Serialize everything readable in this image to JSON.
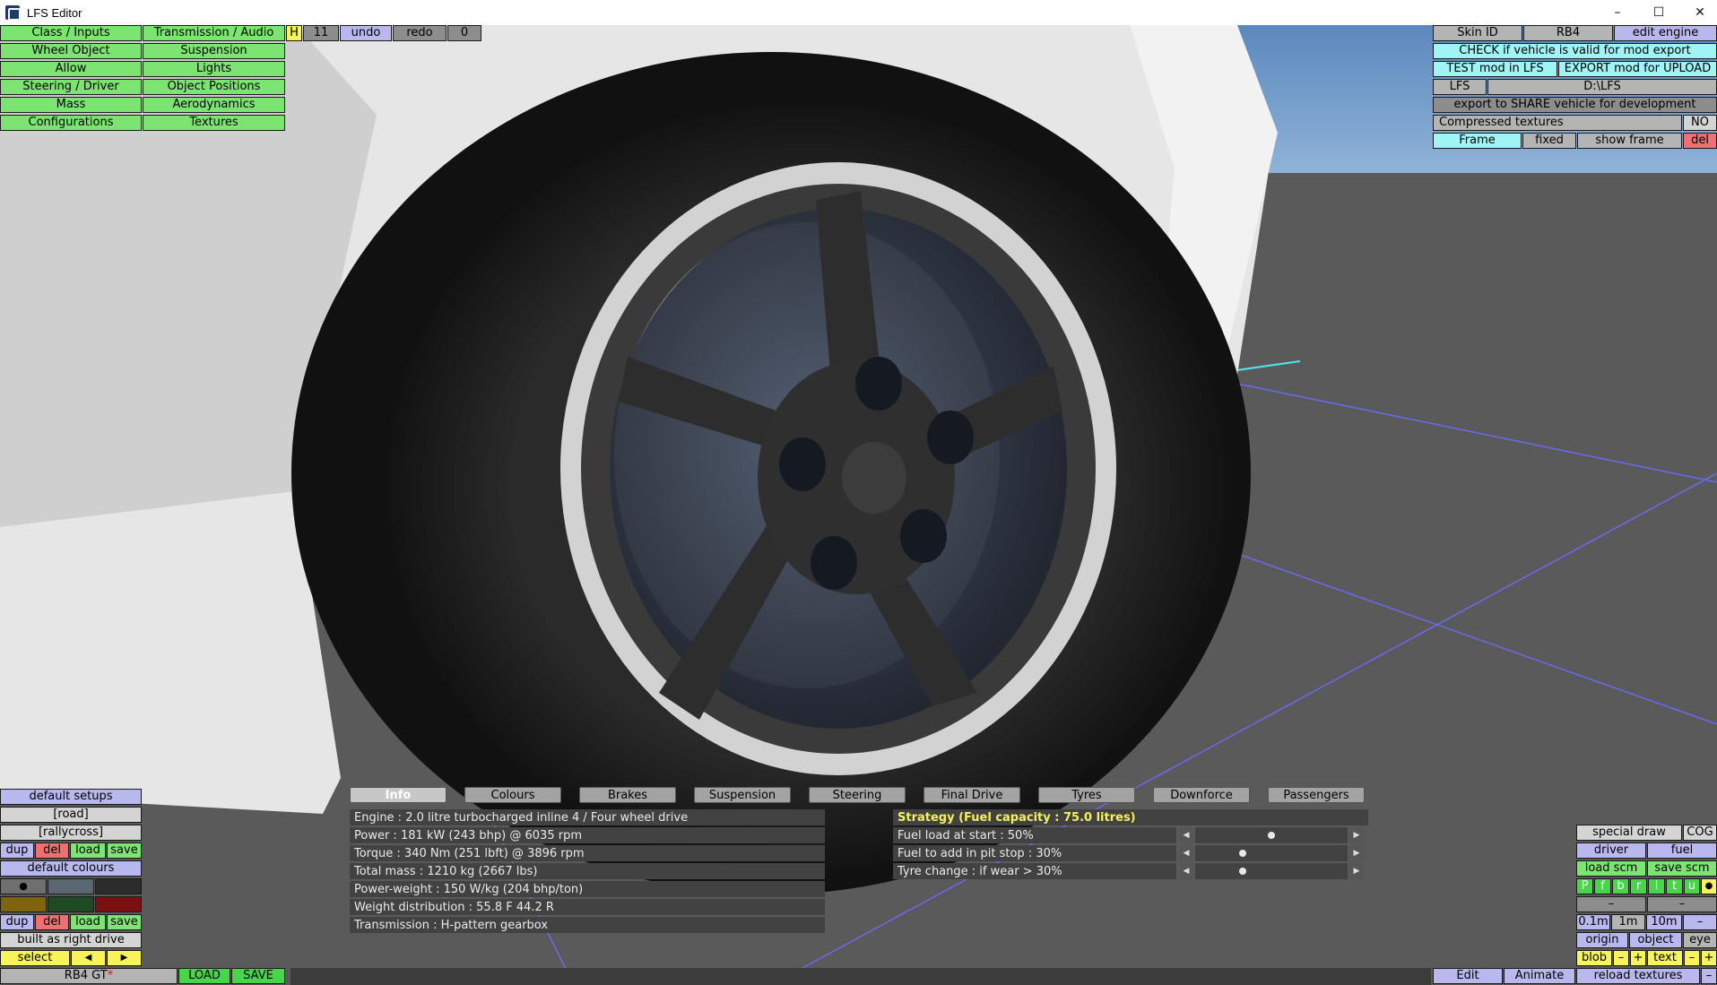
{
  "window": {
    "title": "LFS Editor",
    "minimize": "–",
    "maximize": "☐",
    "close": "✕"
  },
  "left_menu": {
    "col1": [
      "Class / Inputs",
      "Wheel Object",
      "Allow",
      "Steering / Driver",
      "Mass",
      "Configurations"
    ],
    "col2": [
      "Transmission / Audio",
      "Suspension",
      "Lights",
      "Object Positions",
      "Aerodynamics",
      "Textures"
    ]
  },
  "top_tools": {
    "h": "H",
    "count": "11",
    "undo": "undo",
    "redo": "redo",
    "redo_count": "0"
  },
  "right_panel": {
    "skin_id": "Skin ID",
    "car": "RB4",
    "edit_engine": "edit engine",
    "check": "CHECK if vehicle is valid for mod export",
    "test": "TEST mod in LFS",
    "export": "EXPORT mod for UPLOAD",
    "lfs": "LFS",
    "path": "D:\\LFS",
    "share": "export to SHARE vehicle for development",
    "compressed": "Compressed textures",
    "compressed_val": "NO",
    "frame": "Frame",
    "fixed": "fixed",
    "show_frame": "show frame",
    "del": "del"
  },
  "tabs": [
    "Info",
    "Colours",
    "Brakes",
    "Suspension",
    "Steering",
    "Final Drive",
    "Tyres",
    "Downforce",
    "Passengers"
  ],
  "info": [
    "Engine : 2.0 litre turbocharged inline 4 / Four wheel drive",
    "Power : 181 kW (243 bhp) @ 6035 rpm",
    "Torque : 340 Nm (251 lbft) @ 3896 rpm",
    "Total mass : 1210 kg (2667 lbs)",
    "Power-weight : 150 W/kg (204 bhp/ton)",
    "Weight distribution : 55.8 F  44.2 R",
    "Transmission : H-pattern gearbox"
  ],
  "strategy": {
    "title": "Strategy (Fuel capacity : 75.0 litres)",
    "rows": [
      {
        "label": "Fuel load at start : 50%",
        "value": 0.5
      },
      {
        "label": "Fuel to add in pit stop : 30%",
        "value": 0.3
      },
      {
        "label": "Tyre change : if wear > 30%",
        "value": 0.3
      }
    ],
    "left_arrow": "◀",
    "right_arrow": "▶"
  },
  "setups": {
    "default_setups": "default setups",
    "road": "[road]",
    "rallycross": "[rallycross]",
    "dup": "dup",
    "del": "del",
    "load": "load",
    "save": "save",
    "default_colours": "default colours",
    "dot": "●",
    "swatches": [
      "#6f6f6f",
      "#5a6670",
      "#2c2c2c",
      "#80630e",
      "#1e4a24",
      "#7a1010"
    ],
    "built": "built as right drive",
    "select": "select",
    "prev": "◀",
    "next": "▶"
  },
  "bottom_left": {
    "car_name": "RB4 GT",
    "modified_mark": "*",
    "load": "LOAD",
    "save": "SAVE"
  },
  "bottom_right": {
    "special_draw": "special draw",
    "cog": "COG",
    "driver": "driver",
    "fuel": "fuel",
    "load_scm": "load scm",
    "save_scm": "save scm",
    "letters": [
      "P",
      "f",
      "b",
      "r",
      "l",
      "t",
      "u",
      "●"
    ],
    "dash1": "–",
    "dash2": "–",
    "m01": "0.1m",
    "m1": "1m",
    "m10": "10m",
    "minus": "–",
    "origin": "origin",
    "object": "object",
    "eye": "eye",
    "blob": "blob",
    "plus": "+",
    "text": "text",
    "edit": "Edit",
    "animate": "Animate",
    "reload": "reload textures"
  }
}
